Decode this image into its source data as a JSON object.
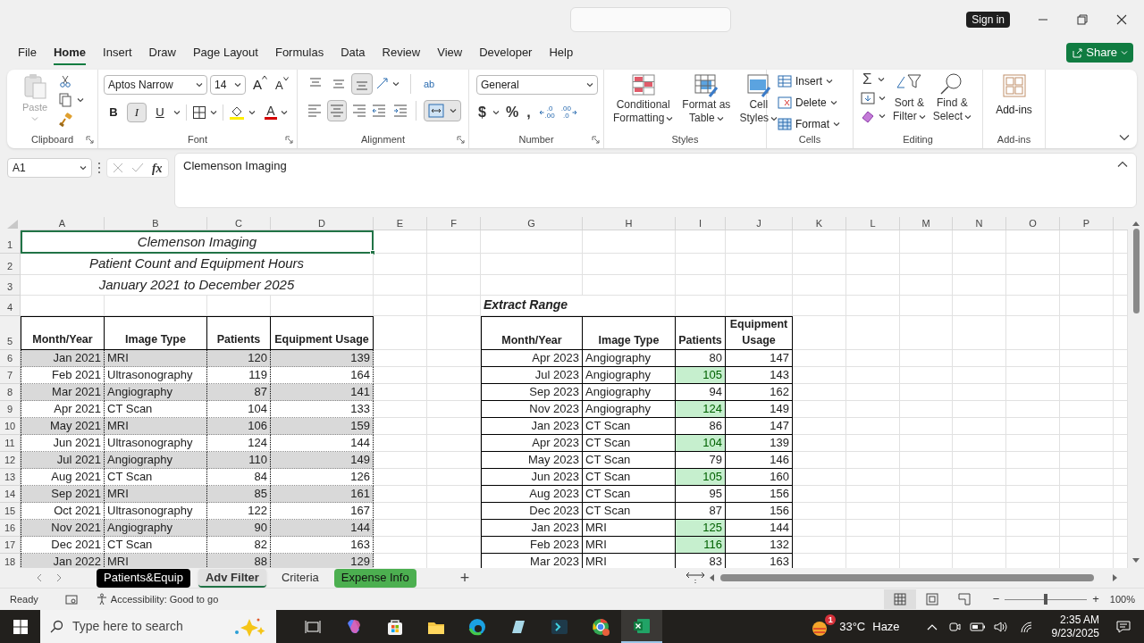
{
  "window": {
    "sign_in": "Sign in"
  },
  "menu": [
    {
      "label": "File",
      "selected": false
    },
    {
      "label": "Home",
      "selected": true
    },
    {
      "label": "Insert",
      "selected": false
    },
    {
      "label": "Draw",
      "selected": false
    },
    {
      "label": "Page Layout",
      "selected": false
    },
    {
      "label": "Formulas",
      "selected": false
    },
    {
      "label": "Data",
      "selected": false
    },
    {
      "label": "Review",
      "selected": false
    },
    {
      "label": "View",
      "selected": false
    },
    {
      "label": "Developer",
      "selected": false
    },
    {
      "label": "Help",
      "selected": false
    }
  ],
  "share": "Share",
  "ribbon": {
    "clipboard": {
      "paste": "Paste",
      "label": "Clipboard"
    },
    "font": {
      "name": "Aptos Narrow",
      "size": "14",
      "grow": "A",
      "shrink": "A",
      "styles": [
        {
          "kind": "bold",
          "label": "B",
          "selected": false
        },
        {
          "kind": "italic",
          "label": "I",
          "selected": true
        },
        {
          "kind": "underline",
          "label": "U",
          "selected": false
        }
      ],
      "font_color": "A",
      "label": "Font"
    },
    "alignment": {
      "vertical": [
        {
          "kind": "top",
          "selected": false
        },
        {
          "kind": "middle",
          "selected": false
        },
        {
          "kind": "bottom",
          "selected": true
        }
      ],
      "horizontal": [
        {
          "kind": "left",
          "selected": false
        },
        {
          "kind": "center",
          "selected": true
        },
        {
          "kind": "right",
          "selected": false
        }
      ],
      "wrap_text": "ab",
      "merge": {
        "selected": true
      },
      "label": "Alignment"
    },
    "number": {
      "format": "General",
      "symbols": [
        "$",
        "%",
        ","
      ],
      "decimals": [
        {
          "kind": "increase",
          "lines": [
            ".0",
            ".00"
          ]
        },
        {
          "kind": "decrease",
          "lines": [
            ".00",
            ".0"
          ]
        }
      ],
      "label": "Number"
    },
    "styles": {
      "buttons": [
        {
          "kind": "conditional",
          "lines": [
            "Conditional",
            "Formatting"
          ]
        },
        {
          "kind": "table",
          "lines": [
            "Format as",
            "Table"
          ]
        },
        {
          "kind": "cell",
          "lines": [
            "Cell",
            "Styles"
          ]
        }
      ],
      "label": "Styles"
    },
    "cells": {
      "buttons": [
        {
          "kind": "insert",
          "label": "Insert"
        },
        {
          "kind": "delete",
          "label": "Delete"
        },
        {
          "kind": "format",
          "label": "Format"
        }
      ],
      "label": "Cells"
    },
    "editing": {
      "sum": "Σ",
      "buttons": [
        {
          "kind": "sort",
          "lines": [
            "Sort &",
            "Filter"
          ]
        },
        {
          "kind": "find",
          "lines": [
            "Find &",
            "Select"
          ]
        }
      ],
      "label": "Editing"
    },
    "addins": {
      "button": "Add-ins",
      "label": "Add-ins"
    }
  },
  "formula_bar": {
    "name_box": "A1",
    "fx": "fx",
    "content": "Clemenson Imaging"
  },
  "columns": [
    "A",
    "B",
    "C",
    "D",
    "E",
    "F",
    "G",
    "H",
    "I",
    "J",
    "K",
    "L",
    "M",
    "N",
    "O",
    "P"
  ],
  "row_numbers": [
    "1",
    "2",
    "3",
    "4",
    "5",
    "6",
    "7",
    "8",
    "9",
    "10",
    "11",
    "12",
    "13",
    "14",
    "15",
    "16",
    "17",
    "18"
  ],
  "title_lines": [
    {
      "text": "Clemenson Imaging",
      "selected": true
    },
    {
      "text": "Patient Count and Equipment Hours",
      "selected": false
    },
    {
      "text": "January 2021 to December 2025",
      "selected": false
    }
  ],
  "main_table": {
    "columns": [
      "Month/Year",
      "Image Type",
      "Patients",
      "Equipment Usage"
    ],
    "rows": [
      {
        "cells": [
          "Jan 2021",
          "MRI",
          "120",
          "139"
        ],
        "shaded": true
      },
      {
        "cells": [
          "Feb 2021",
          "Ultrasonography",
          "119",
          "164"
        ],
        "shaded": false
      },
      {
        "cells": [
          "Mar 2021",
          "Angiography",
          "87",
          "141"
        ],
        "shaded": true
      },
      {
        "cells": [
          "Apr 2021",
          "CT Scan",
          "104",
          "133"
        ],
        "shaded": false
      },
      {
        "cells": [
          "May 2021",
          "MRI",
          "106",
          "159"
        ],
        "shaded": true
      },
      {
        "cells": [
          "Jun 2021",
          "Ultrasonography",
          "124",
          "144"
        ],
        "shaded": false
      },
      {
        "cells": [
          "Jul 2021",
          "Angiography",
          "110",
          "149"
        ],
        "shaded": true
      },
      {
        "cells": [
          "Aug 2021",
          "CT Scan",
          "84",
          "126"
        ],
        "shaded": false
      },
      {
        "cells": [
          "Sep 2021",
          "MRI",
          "85",
          "161"
        ],
        "shaded": true
      },
      {
        "cells": [
          "Oct 2021",
          "Ultrasonography",
          "122",
          "167"
        ],
        "shaded": false
      },
      {
        "cells": [
          "Nov 2021",
          "Angiography",
          "90",
          "144"
        ],
        "shaded": true
      },
      {
        "cells": [
          "Dec 2021",
          "CT Scan",
          "82",
          "163"
        ],
        "shaded": false
      },
      {
        "cells": [
          "Jan 2022",
          "MRI",
          "88",
          "129"
        ],
        "shaded": true
      }
    ]
  },
  "extract_range": {
    "title": "Extract Range",
    "columns": [
      "Month/Year",
      "Image Type",
      "Patients",
      "Equipment Usage"
    ],
    "rows": [
      {
        "cells": [
          "Apr 2023",
          "Angiography",
          "80",
          "147"
        ],
        "highlighted": false
      },
      {
        "cells": [
          "Jul 2023",
          "Angiography",
          "105",
          "143"
        ],
        "highlighted": true
      },
      {
        "cells": [
          "Sep 2023",
          "Angiography",
          "94",
          "162"
        ],
        "highlighted": false
      },
      {
        "cells": [
          "Nov 2023",
          "Angiography",
          "124",
          "149"
        ],
        "highlighted": true
      },
      {
        "cells": [
          "Jan 2023",
          "CT Scan",
          "86",
          "147"
        ],
        "highlighted": false
      },
      {
        "cells": [
          "Apr 2023",
          "CT Scan",
          "104",
          "139"
        ],
        "highlighted": true
      },
      {
        "cells": [
          "May 2023",
          "CT Scan",
          "79",
          "146"
        ],
        "highlighted": false
      },
      {
        "cells": [
          "Jun 2023",
          "CT Scan",
          "105",
          "160"
        ],
        "highlighted": true
      },
      {
        "cells": [
          "Aug 2023",
          "CT Scan",
          "95",
          "156"
        ],
        "highlighted": false
      },
      {
        "cells": [
          "Dec 2023",
          "CT Scan",
          "87",
          "156"
        ],
        "highlighted": false
      },
      {
        "cells": [
          "Jan 2023",
          "MRI",
          "125",
          "144"
        ],
        "highlighted": true
      },
      {
        "cells": [
          "Feb 2023",
          "MRI",
          "116",
          "132"
        ],
        "highlighted": true
      },
      {
        "cells": [
          "Mar 2023",
          "MRI",
          "83",
          "163"
        ],
        "highlighted": false
      }
    ]
  },
  "sheet_tabs": [
    {
      "label": "Patients&Equip",
      "selected": false,
      "color": "#000000"
    },
    {
      "label": "Adv Filter",
      "selected": true
    },
    {
      "label": "Criteria",
      "selected": false
    },
    {
      "label": "Expense Info",
      "selected": false,
      "color": "#4caf50"
    }
  ],
  "add_sheet": "+",
  "status": {
    "mode": "Ready",
    "accessibility": "Accessibility: Good to go",
    "views": [
      {
        "kind": "normal",
        "selected": true
      },
      {
        "kind": "page_layout",
        "selected": false
      },
      {
        "kind": "page_break",
        "selected": false
      }
    ],
    "zoom_out": "−",
    "zoom_in": "+",
    "zoom_slider": {
      "level": 0.5
    },
    "zoom": "100%"
  },
  "taskbar": {
    "search_placeholder": "Type here to search",
    "apps": [
      {
        "kind": "taskview",
        "active": false
      },
      {
        "kind": "copilot",
        "active": false
      },
      {
        "kind": "store",
        "active": false
      },
      {
        "kind": "explorer",
        "active": false
      },
      {
        "kind": "edge",
        "active": false
      },
      {
        "kind": "notes",
        "active": false
      },
      {
        "kind": "terminal",
        "active": false
      },
      {
        "kind": "chrome",
        "active": false
      },
      {
        "kind": "excel",
        "active": true
      }
    ],
    "weather": {
      "badge": "1",
      "temp": "33°C",
      "condition": "Haze"
    },
    "time": "2:35 AM",
    "date": "9/23/2025"
  }
}
